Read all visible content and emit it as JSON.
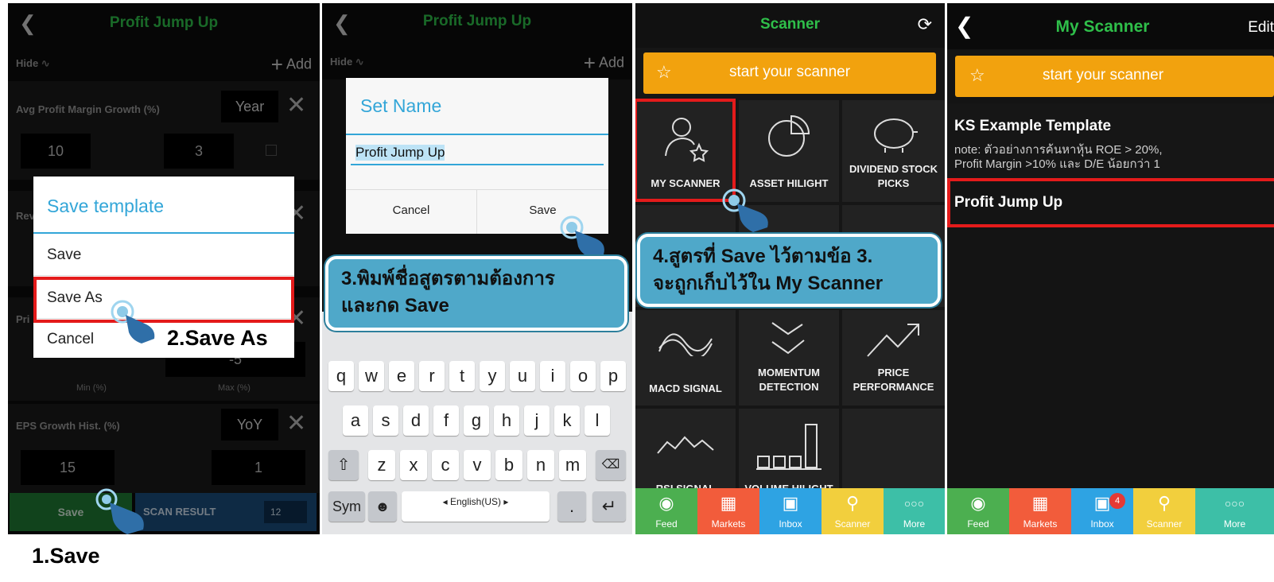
{
  "p1": {
    "title": "Profit Jump Up",
    "hide_label": "Hide",
    "add_label": "Add",
    "row1_label": "Avg Profit Margin Growth (%)",
    "row1_period": "Year",
    "row1_val_a": "10",
    "row1_val_b": "3",
    "row2_label": "Rev",
    "row3_label": "Pri",
    "row3_val": "-5",
    "min_label": "Min (%)",
    "max_label": "Max (%)",
    "row4_label": "EPS Growth Hist. (%)",
    "row4_period": "YoY",
    "row4_val_a": "15",
    "row4_val_b": "1",
    "save_btn": "Save",
    "scan_result": "SCAN RESULT",
    "scan_count": "12",
    "dialog_title": "Save template",
    "dialog_save": "Save",
    "dialog_save_as": "Save As",
    "dialog_cancel": "Cancel",
    "step2": "2.Save As",
    "step1": "1.Save"
  },
  "p2": {
    "title": "Profit Jump Up",
    "hide_label": "Hide",
    "add_label": "Add",
    "dialog_title": "Set Name",
    "name_value": "Profit Jump Up",
    "cancel": "Cancel",
    "save": "Save",
    "callout_line1": "3.พิมพ์ชื่อสูตรตามต้องการ",
    "callout_line2": "และกด Save",
    "row1": [
      "q",
      "w",
      "e",
      "r",
      "t",
      "y",
      "u",
      "i",
      "o",
      "p"
    ],
    "row2": [
      "a",
      "s",
      "d",
      "f",
      "g",
      "h",
      "j",
      "k",
      "l"
    ],
    "row3": [
      "z",
      "x",
      "c",
      "v",
      "b",
      "n",
      "m"
    ],
    "sym": "Sym",
    "lang": "◂ English(US) ▸",
    "dot": "."
  },
  "p3": {
    "title": "Scanner",
    "start": "start your scanner",
    "tile_my_scanner": "MY SCANNER",
    "tile_asset_hilight": "ASSET HILIGHT",
    "tile_dividend_1": "DIVIDEND STOCK",
    "tile_dividend_2": "PICKS",
    "tile_macd": "MACD SIGNAL",
    "tile_momentum_1": "MOMENTUM",
    "tile_momentum_2": "DETECTION",
    "tile_price_1": "PRICE",
    "tile_price_2": "PERFORMANCE",
    "tile_rsi": "RSI SIGNAL",
    "tile_volume": "VOLUME HILIGHT",
    "callout_line1": "4.สูตรที่ Save ไว้ตามข้อ 3.",
    "callout_line2": "จะถูกเก็บไว้ใน My Scanner",
    "tabs": [
      "Feed",
      "Markets",
      "Inbox",
      "Scanner",
      "More"
    ]
  },
  "p4": {
    "title": "My Scanner",
    "edit": "Edit",
    "start": "start your scanner",
    "template_title": "KS Example Template",
    "template_note1": "note: ตัวอย่างการค้นหาหุ้น ROE > 20%,",
    "template_note2": "Profit Margin >10% และ D/E น้อยกว่า 1",
    "item": "Profit Jump Up",
    "inbox_badge": "4",
    "tabs": [
      "Feed",
      "Markets",
      "Inbox",
      "Scanner",
      "More"
    ]
  },
  "colors": {
    "accent_green": "#2fbf4a",
    "dialog_blue": "#33a6d8",
    "highlight_red": "#e41b1b",
    "callout_blue": "#4fa8c9",
    "scanner_orange": "#f2a20e",
    "tab_feed": "#4caf50",
    "tab_markets": "#f25c3b",
    "tab_inbox": "#2ea3e3",
    "tab_scanner": "#f2cf3d",
    "tab_more": "#3dbfa7"
  }
}
